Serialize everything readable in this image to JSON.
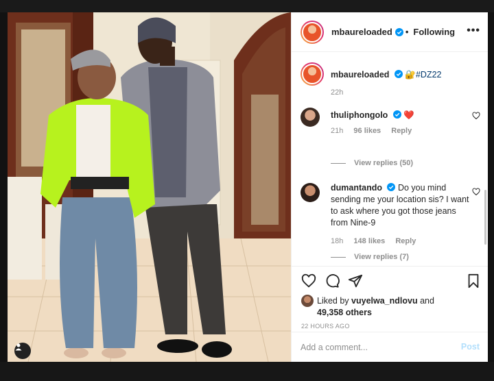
{
  "post": {
    "author": "mbaureloaded",
    "following_label": "Following",
    "separator": "•",
    "more_label": "•••"
  },
  "caption": {
    "username": "mbaureloaded",
    "text": "🔐#DZ22",
    "time": "22h"
  },
  "comments": [
    {
      "username": "thuliphongolo",
      "text": "❤️",
      "time": "21h",
      "likes": "96 likes",
      "reply_label": "Reply",
      "view_replies": "View replies (50)"
    },
    {
      "username": "dumantando",
      "text": "Do you mind sending me your location sis? I want to ask where you got those jeans from Nine-9",
      "time": "18h",
      "likes": "148 likes",
      "reply_label": "Reply",
      "view_replies": "View replies (7)"
    }
  ],
  "likes": {
    "prefix": "Liked by",
    "user": "vuyelwa_ndlovu",
    "and": "and",
    "count": "49,358 others"
  },
  "timestamp": "22 HOURS AGO",
  "add_comment": {
    "placeholder": "Add a comment...",
    "post_label": "Post"
  },
  "colors": {
    "link_blue": "#00376b",
    "muted_grey": "#8e8e8e",
    "verified_blue": "#0095f6",
    "post_disabled_blue": "#b2dffc",
    "heart_red": "#ed4956"
  }
}
